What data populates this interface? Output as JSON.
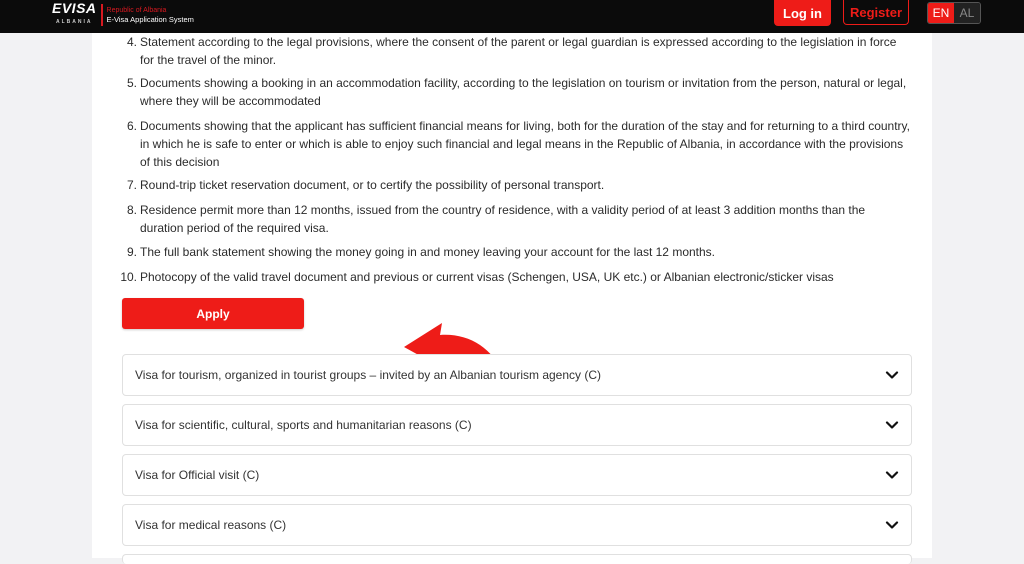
{
  "header": {
    "logo_mark": "EVISA",
    "logo_sub": "ALBANIA",
    "logo_line1": "Republic of Albania",
    "logo_line2": "E-Visa Application System",
    "login_label": "Log in",
    "register_label": "Register",
    "lang_en": "EN",
    "lang_al": "AL"
  },
  "requirements": [
    {
      "num": "4.",
      "text": "Statement according to the legal provisions, where the consent of the parent or legal guardian is expressed according to the legislation in force for the travel of the minor."
    },
    {
      "num": "5.",
      "text": "Documents showing a booking in an accommodation facility, according to the legislation on tourism or invitation from the person, natural or legal, where they will be accommodated"
    },
    {
      "num": "6.",
      "text": "Documents showing that the applicant has sufficient financial means for living, both for the duration of the stay and for returning to a third country, in which he is safe to enter or which is able to enjoy such financial and legal means in the Republic of Albania, in accordance with the provisions of this decision"
    },
    {
      "num": "7.",
      "text": "Round-trip ticket reservation document, or to certify the possibility of personal transport."
    },
    {
      "num": "8.",
      "text": "Residence permit more than 12 months, issued from the country of residence, with a validity period of at least 3 addition months than the duration period of the required visa."
    },
    {
      "num": "9.",
      "text": "The full bank statement showing the money going in and money leaving your account for the last 12 months."
    },
    {
      "num": "10.",
      "text": "Photocopy of the valid travel document and previous or current visas (Schengen, USA, UK etc.) or Albanian electronic/sticker visas"
    }
  ],
  "apply_label": "Apply",
  "accordion": [
    {
      "label": "Visa for tourism, organized in tourist groups – invited by an Albanian tourism agency (C)"
    },
    {
      "label": "Visa for scientific, cultural, sports and humanitarian reasons (C)"
    },
    {
      "label": "Visa for Official visit (C)"
    },
    {
      "label": "Visa for medical reasons (C)"
    }
  ],
  "colors": {
    "accent": "#ee1c18",
    "topbar": "#0b0b0b"
  }
}
